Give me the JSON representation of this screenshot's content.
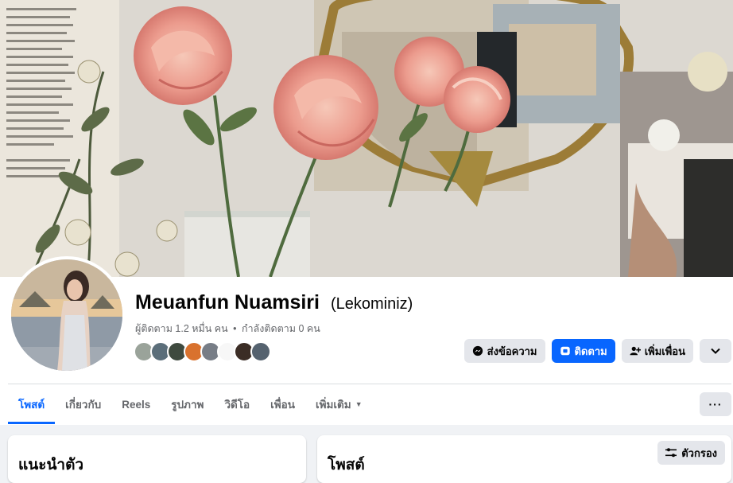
{
  "profile": {
    "name": "Meuanfun Nuamsiri",
    "alternate_name": "(Lekominiz)",
    "followers_text": "ผู้ติดตาม 1.2 หมื่น คน",
    "separator": "•",
    "following_text": "กำลังติดตาม 0 คน",
    "friend_avatars": [
      "#9aa39a",
      "#5b6e7a",
      "#3f4a3f",
      "#d9722e",
      "#777d86",
      "#f7f7f7",
      "#3b2d25",
      "#55626f"
    ]
  },
  "actions": {
    "message_label": "ส่งข้อความ",
    "follow_label": "ติดตาม",
    "add_friend_label": "เพิ่มเพื่อน"
  },
  "tabs": [
    {
      "label": "โพสต์",
      "active": true
    },
    {
      "label": "เกี่ยวกับ"
    },
    {
      "label": "Reels"
    },
    {
      "label": "รูปภาพ"
    },
    {
      "label": "วิดีโอ"
    },
    {
      "label": "เพื่อน"
    },
    {
      "label": "เพิ่มเติม"
    }
  ],
  "more_menu_label": "···",
  "intro_card": {
    "title": "แนะนำตัว"
  },
  "posts_card": {
    "title": "โพสต์",
    "filter_label": "ตัวกรอง"
  },
  "colors": {
    "accent": "#0866ff",
    "secondary_text": "#65676b",
    "button_grey": "#e4e6eb"
  }
}
